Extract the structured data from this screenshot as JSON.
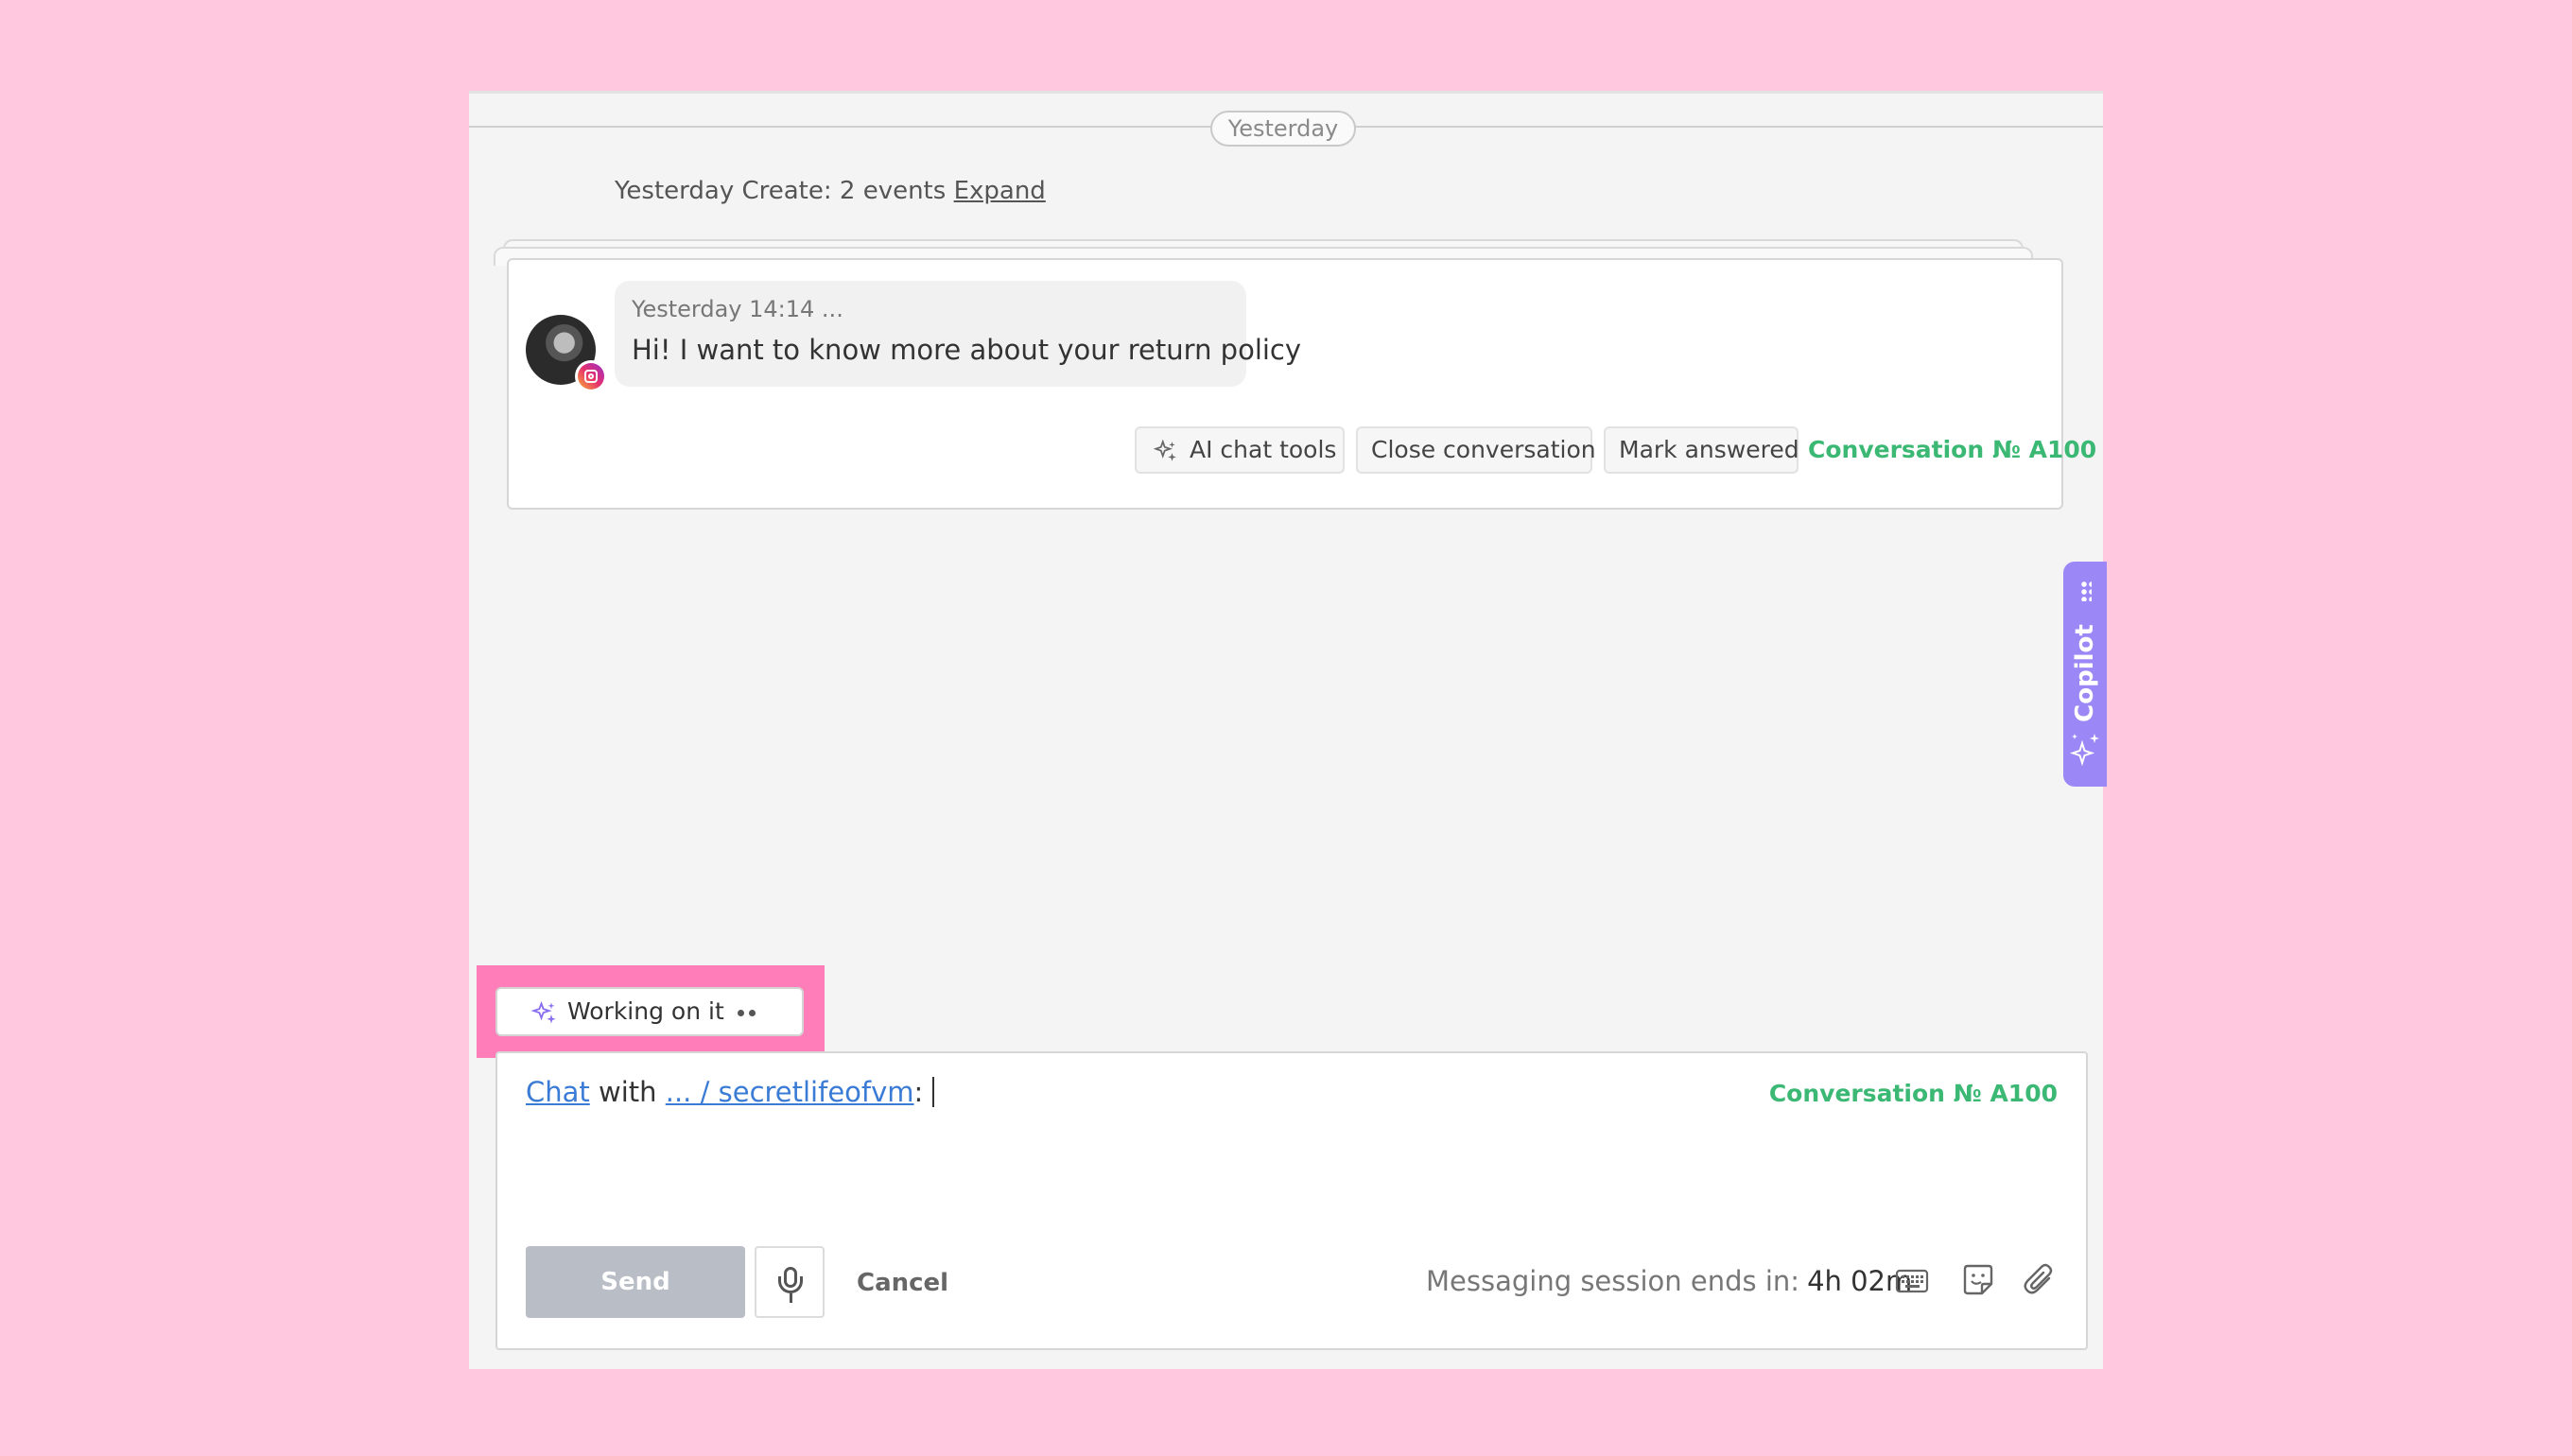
{
  "timeline": {
    "date_divider": "Yesterday",
    "events_summary": "Yesterday Create: 2 events",
    "expand_link": "Expand"
  },
  "message": {
    "timestamp": "Yesterday 14:14 ...",
    "text": "Hi! I want to know more about your return policy",
    "channel_icon": "instagram-icon"
  },
  "card_actions": {
    "ai_tools": "AI chat tools",
    "close_conversation": "Close conversation",
    "mark_answered": "Mark answered",
    "conversation_number": "Conversation № A100"
  },
  "copilot": {
    "label": "Copilot"
  },
  "status": {
    "working": "Working on it"
  },
  "composer": {
    "chat_link": "Chat",
    "with_text": "with",
    "contact_link": "... / secretlifeofvm",
    "colon": ":",
    "conversation_number": "Conversation № A100",
    "send_label": "Send",
    "cancel_label": "Cancel",
    "session_label": "Messaging session ends in:",
    "session_time": "4h 02m"
  },
  "colors": {
    "accent_green": "#3bb874",
    "link_blue": "#3a7bd5",
    "copilot_purple": "#9b87f5",
    "highlight_pink": "#ff7db8",
    "background_pink": "#ffc8de"
  }
}
